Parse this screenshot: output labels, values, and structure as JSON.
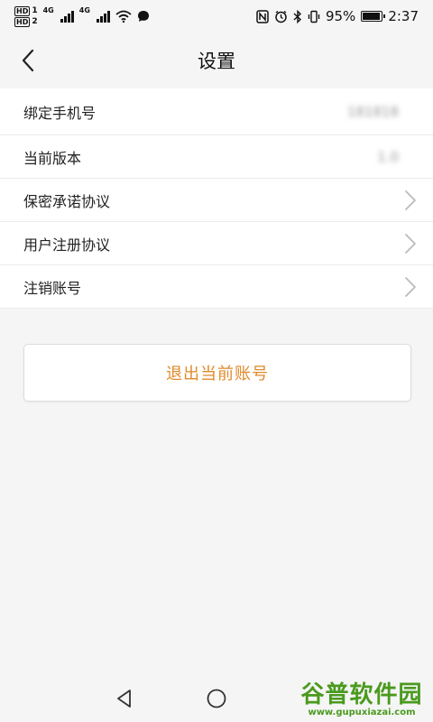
{
  "status_bar": {
    "sim1": "HD",
    "sim1_num": "1",
    "sim2": "HD",
    "sim2_num": "2",
    "net1": "4G",
    "net2": "4G",
    "battery_percent": "95%",
    "battery_level": 0.95,
    "time": "2:37"
  },
  "header": {
    "title": "设置"
  },
  "settings": {
    "items": [
      {
        "label": "绑定手机号",
        "value": "181818"
      },
      {
        "label": "当前版本",
        "value": "1.0"
      },
      {
        "label": "保密承诺协议"
      },
      {
        "label": "用户注册协议"
      },
      {
        "label": "注销账号"
      }
    ]
  },
  "logout": {
    "label": "退出当前账号"
  },
  "watermark": {
    "title": "谷普软件园",
    "url": "www.gupuxiazai.com"
  },
  "colors": {
    "accent": "#e08a2b",
    "watermark": "#4a9a1e"
  }
}
